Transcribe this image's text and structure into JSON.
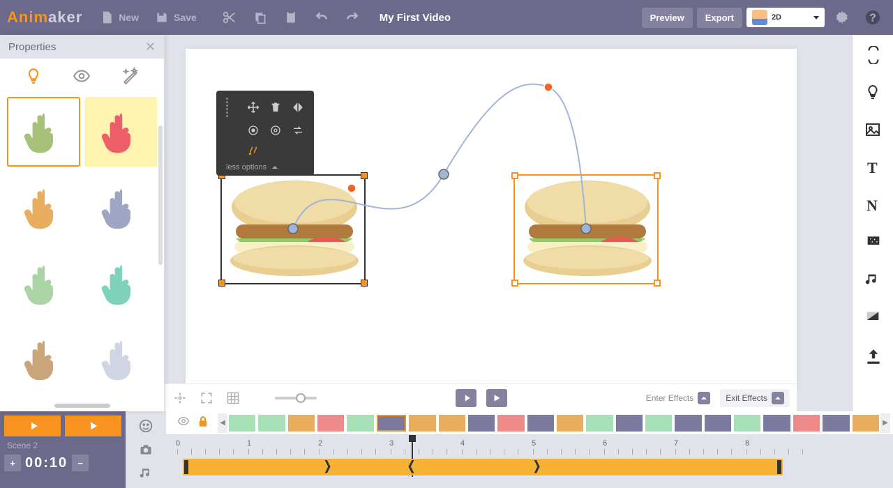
{
  "app": {
    "logo_a": "Anim",
    "logo_b": "aker"
  },
  "toolbar": {
    "new_label": "New",
    "save_label": "Save",
    "title": "My First Video",
    "preview": "Preview",
    "export": "Export",
    "mode": "2D"
  },
  "properties": {
    "title": "Properties",
    "hands": [
      {
        "color": "#a6c17a",
        "sel": true,
        "bg": false
      },
      {
        "color": "#ed5e68",
        "sel": false,
        "bg": true
      },
      {
        "color": "#e8ad5e",
        "sel": false,
        "bg": false
      },
      {
        "color": "#9ea6c4",
        "sel": false,
        "bg": false
      },
      {
        "color": "#aad4a4",
        "sel": false,
        "bg": false
      },
      {
        "color": "#7fd1b9",
        "sel": false,
        "bg": false
      },
      {
        "color": "#c9a67a",
        "sel": false,
        "bg": false
      },
      {
        "color": "#d0d5e4",
        "sel": false,
        "bg": false
      }
    ]
  },
  "context_toolbar": {
    "less_options": "less options"
  },
  "canvas_controls": {
    "enter_effects": "Enter Effects",
    "exit_effects": "Exit Effects"
  },
  "timeline": {
    "scene_label": "Scene 2",
    "time": "00:10",
    "ruler": [
      "0",
      "1",
      "2",
      "3",
      "4",
      "5",
      "6",
      "7",
      "8"
    ],
    "scene_colors": [
      "#a8e0b8",
      "#a8e0b8",
      "#e8ad5e",
      "#ed8a8a",
      "#a8e0b8",
      "#7d7aa0",
      "#e8ad5e",
      "#e8ad5e",
      "#7d7aa0",
      "#ed8a8a",
      "#7d7aa0",
      "#e8ad5e",
      "#a8e0b8",
      "#7d7aa0",
      "#a8e0b8",
      "#7d7aa0",
      "#7d7aa0",
      "#a8e0b8",
      "#7d7aa0",
      "#ed8a8a",
      "#7d7aa0",
      "#e8ad5e"
    ],
    "selected_scene_index": 5
  }
}
